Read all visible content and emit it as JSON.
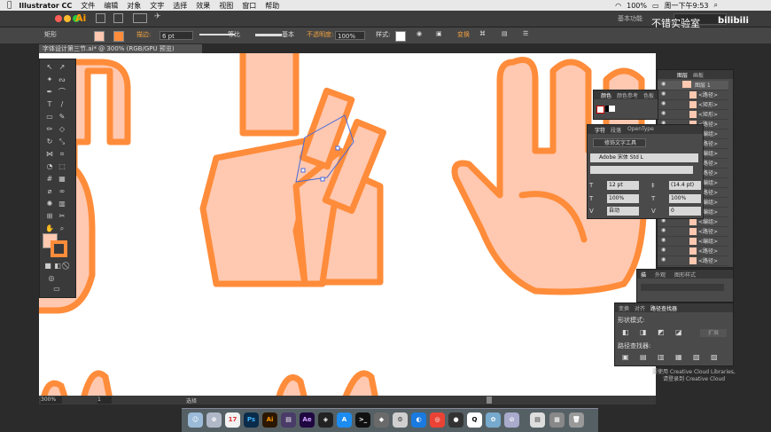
{
  "menubar": {
    "app": "Illustrator CC",
    "items": [
      "文件",
      "编辑",
      "对象",
      "文字",
      "选择",
      "效果",
      "视图",
      "窗口",
      "帮助"
    ],
    "battery": "100%",
    "clock": "周一下午9:53"
  },
  "appbar": {
    "logo": "Ai",
    "workspace": "基本功能",
    "watermark": "不错实验室"
  },
  "control": {
    "shape_label": "矩形",
    "stroke_label": "描边:",
    "stroke_value": "6 pt",
    "stroke_style": "等比",
    "brush_style": "基本",
    "opacity_label": "不透明度:",
    "opacity_value": "100%",
    "style_label": "样式:",
    "transform_label": "变换"
  },
  "document": {
    "tab_title": "字体设计第三节.ai* @ 300% (RGB/GPU 预览)"
  },
  "status": {
    "zoom": "300%",
    "page": "1",
    "mode": "选择"
  },
  "layers_panel": {
    "tabs": [
      "图层",
      "画板"
    ],
    "layer_name": "图层 1",
    "rows": [
      "<路径>",
      "<矩形>",
      "<矩形>",
      "<路径>",
      "<编组>",
      "<路径>",
      "<编组>",
      "<路径>",
      "<路径>",
      "<编组>",
      "<路径>",
      "<编组>",
      "<编组>",
      "<编组>",
      "<路径>",
      "<编组>",
      "<路径>",
      "<路径>"
    ]
  },
  "color_panel": {
    "tabs": [
      "颜色",
      "颜色参考",
      "色板"
    ]
  },
  "char_panel": {
    "tabs": [
      "字符",
      "段落",
      "OpenType"
    ],
    "touch_tool": "修饰文字工具",
    "font": "Adobe 宋体 Std L",
    "size": "12 pt",
    "leading": "(14.4 pt)",
    "scale_h": "100%",
    "scale_v": "100%",
    "kerning": "自动",
    "tracking": "0"
  },
  "align_panel": {
    "tabs": [
      "描",
      "外观",
      "图形样式"
    ]
  },
  "pathfinder_panel": {
    "tabs": [
      "变换",
      "对齐",
      "路径查找器"
    ],
    "shape_modes": "形状模式:",
    "pathfinders": "路径查找器:",
    "expand": "扩展"
  },
  "libraries": {
    "line1": "要使用 Creative Cloud Libraries,",
    "line2": "请登录到 Creative Cloud"
  },
  "colors": {
    "fill": "#ffc8b0",
    "stroke": "#ff8c3a",
    "accent": "#f0a040"
  }
}
